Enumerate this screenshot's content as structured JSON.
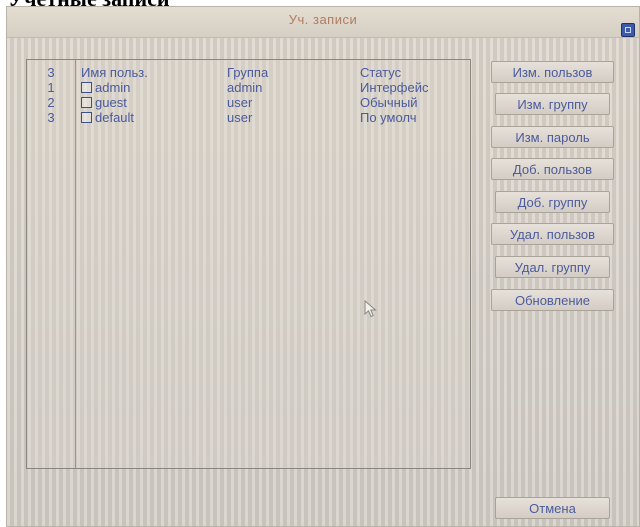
{
  "document_heading": "Учетные записи",
  "window": {
    "title": "Уч. записи"
  },
  "table": {
    "header": {
      "index": "3",
      "name": "Имя польз.",
      "group": "Группа",
      "status": "Статус"
    },
    "rows": [
      {
        "index": "1",
        "name": "admin",
        "group": "admin",
        "status": "Интерфейс"
      },
      {
        "index": "2",
        "name": "guest",
        "group": "user",
        "status": "Обычный"
      },
      {
        "index": "3",
        "name": "default",
        "group": "user",
        "status": "По умолч"
      }
    ]
  },
  "side_buttons": [
    "Изм. пользов",
    "Изм. группу",
    "Изм. пароль",
    "Доб. пользов",
    "Доб. группу",
    "Удал. пользов",
    "Удал. группу",
    "Обновление"
  ],
  "cancel_label": "Отмена",
  "icons": {
    "close": "close-icon",
    "cursor": "mouse-cursor-icon"
  }
}
